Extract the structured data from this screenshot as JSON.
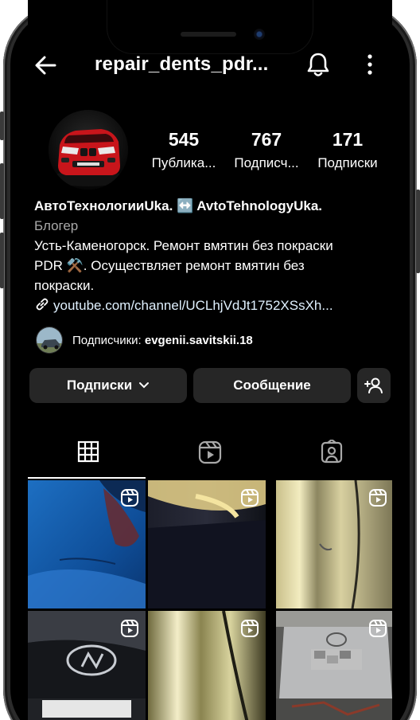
{
  "header": {
    "username": "repair_dents_pdr...",
    "back_icon": "back-arrow-icon",
    "bell_icon": "bell-icon",
    "more_icon": "more-vertical-icon"
  },
  "stats": [
    {
      "value": "545",
      "label": "Публика..."
    },
    {
      "value": "767",
      "label": "Подписч..."
    },
    {
      "value": "171",
      "label": "Подписки"
    }
  ],
  "bio": {
    "name": "АвтоТехнологииUka. ↔️ AvtoTehnologyUka.",
    "category": "Блогер",
    "text_line1": "Усть-Каменогорск. Ремонт вмятин без покраски",
    "text_line2": "PDR ⚒️.  Осуществляет ремонт вмятин без",
    "text_line3": "покраски.",
    "link": "youtube.com/channel/UCLhjVdJt1752XSsXh..."
  },
  "followed_by": {
    "prefix": "Подписчики: ",
    "username": "evgenii.savitskii.18"
  },
  "buttons": {
    "following": "Подписки",
    "message": "Сообщение"
  },
  "tabs": [
    "grid-icon",
    "reels-icon",
    "tagged-icon"
  ],
  "colors": {
    "background": "#000000",
    "button_bg": "#262626",
    "secondary_text": "#a8a8a8",
    "link_text": "#e0f1ff",
    "avatar_car": "#c8151b"
  }
}
